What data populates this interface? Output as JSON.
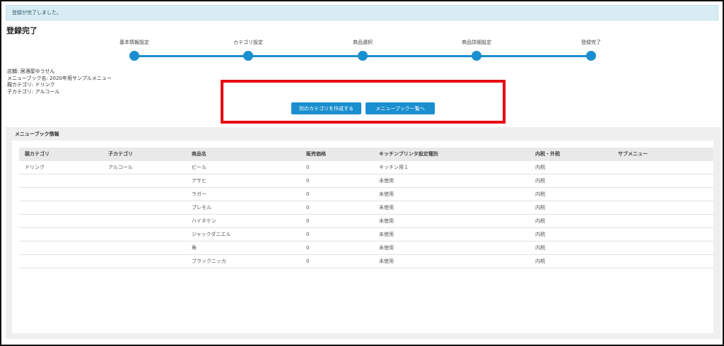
{
  "alert": {
    "message": "登録が完了しました。"
  },
  "page": {
    "title": "登録完了"
  },
  "steps": [
    {
      "label": "基本情報設定"
    },
    {
      "label": "カテゴリ設定"
    },
    {
      "label": "商品選択"
    },
    {
      "label": "商品詳細設定"
    },
    {
      "label": "登録完了"
    }
  ],
  "info": {
    "store": "店舗: 居酒屋ゆうせん",
    "menubook": "メニューブック名: 2020年用サンプルメニュー",
    "parent": "親カテゴリ: ドリンク",
    "child": "子カテゴリ: アルコール"
  },
  "buttons": {
    "create_other": "別のカテゴリを作成する",
    "menubook_list": "メニューブック一覧へ"
  },
  "section": {
    "title": "メニューブック情報"
  },
  "table": {
    "headers": [
      "親カテゴリ",
      "子カテゴリ",
      "商品名",
      "販売価格",
      "キッチンプリンタ設定種別",
      "内税・外税",
      "サブメニュー"
    ],
    "rows": [
      [
        "ドリンク",
        "アルコール",
        "ビール",
        "0",
        "キッチン用１",
        "内税",
        ""
      ],
      [
        "",
        "",
        "アサヒ",
        "0",
        "未使用",
        "内税",
        ""
      ],
      [
        "",
        "",
        "ラガー",
        "0",
        "未使用",
        "内税",
        ""
      ],
      [
        "",
        "",
        "プレモル",
        "0",
        "未使用",
        "内税",
        ""
      ],
      [
        "",
        "",
        "ハイネケン",
        "0",
        "未使用",
        "内税",
        ""
      ],
      [
        "",
        "",
        "ジャックダニエル",
        "0",
        "未使用",
        "内税",
        ""
      ],
      [
        "",
        "",
        "角",
        "0",
        "未使用",
        "内税",
        ""
      ],
      [
        "",
        "",
        "ブラックニッカ",
        "0",
        "未使用",
        "内税",
        ""
      ]
    ]
  },
  "colors": {
    "accent": "#1a8fcf",
    "highlight": "#e60012",
    "alert_bg": "#d8edf3"
  }
}
